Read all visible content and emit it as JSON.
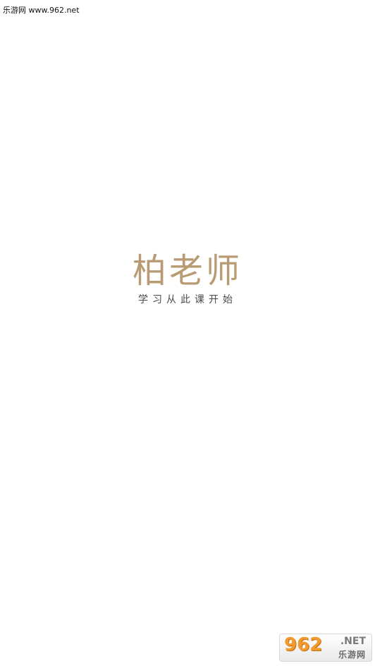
{
  "watermark": {
    "top_text": "乐游网 www.962.net",
    "badge_main": "962",
    "badge_suffix": ".NET",
    "badge_sub": "乐游网"
  },
  "splash": {
    "title": "柏老师",
    "slogan": "学习从此课开始",
    "title_color": "#b89b73",
    "slogan_color": "#4a4a4a",
    "background_color": "#ffffff"
  }
}
